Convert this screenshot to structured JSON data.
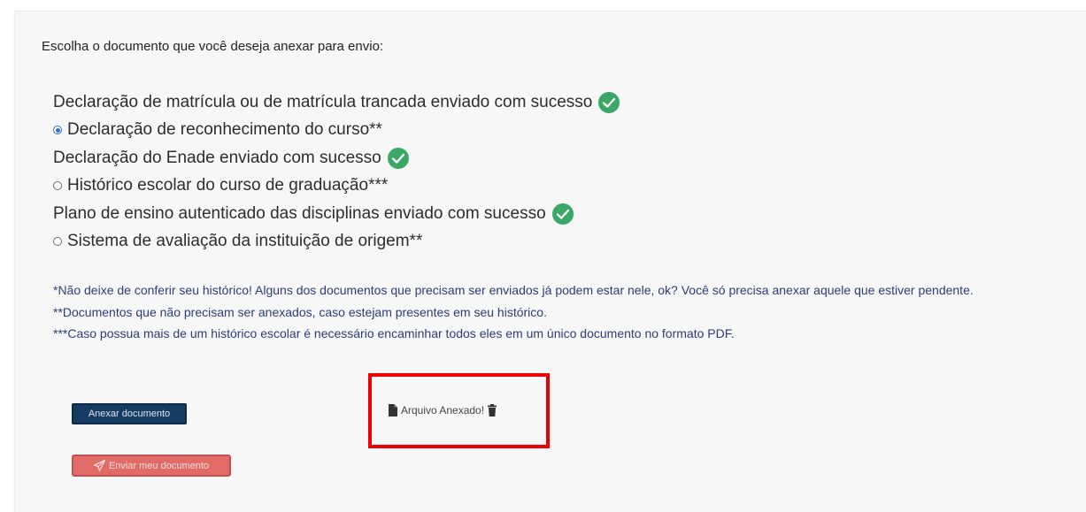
{
  "instruction": "Escolha o documento que você deseja anexar para envio:",
  "options": [
    {
      "label": "Declaração de matrícula ou de matrícula trancada enviado com sucesso",
      "status": "sent"
    },
    {
      "label": "Declaração de reconhecimento do curso**",
      "status": "radio-selected"
    },
    {
      "label": "Declaração do Enade enviado com sucesso",
      "status": "sent"
    },
    {
      "label": "Histórico escolar do curso de graduação***",
      "status": "radio"
    },
    {
      "label": "Plano de ensino autenticado das disciplinas enviado com sucesso",
      "status": "sent"
    },
    {
      "label": "Sistema de avaliação da instituição de origem**",
      "status": "radio"
    }
  ],
  "notes": {
    "note1": "*Não deixe de conferir seu histórico! Alguns dos documentos que precisam ser enviados já podem estar nele, ok? Você só precisa anexar aquele que estiver pendente.",
    "note2": "**Documentos que não precisam ser anexados, caso estejam presentes em seu histórico.",
    "note3": "***Caso possua mais de um histórico escolar é necessário encaminhar todos eles em um único documento no formato PDF."
  },
  "buttons": {
    "attach_label": "Anexar documento",
    "send_label": "Enviar meu documento"
  },
  "attached_status": "Arquivo Anexado!",
  "icons": {
    "sent": "check-circle-icon",
    "file": "file-icon",
    "remove": "trash-icon",
    "send": "paper-plane-icon"
  },
  "colors": {
    "check_green": "#3aa865",
    "radio_blue": "#2f6fcf",
    "notes_text": "#2b3c79",
    "attach_button": "#153b63",
    "send_button": "#e16b66",
    "highlight": "#ee0000"
  }
}
